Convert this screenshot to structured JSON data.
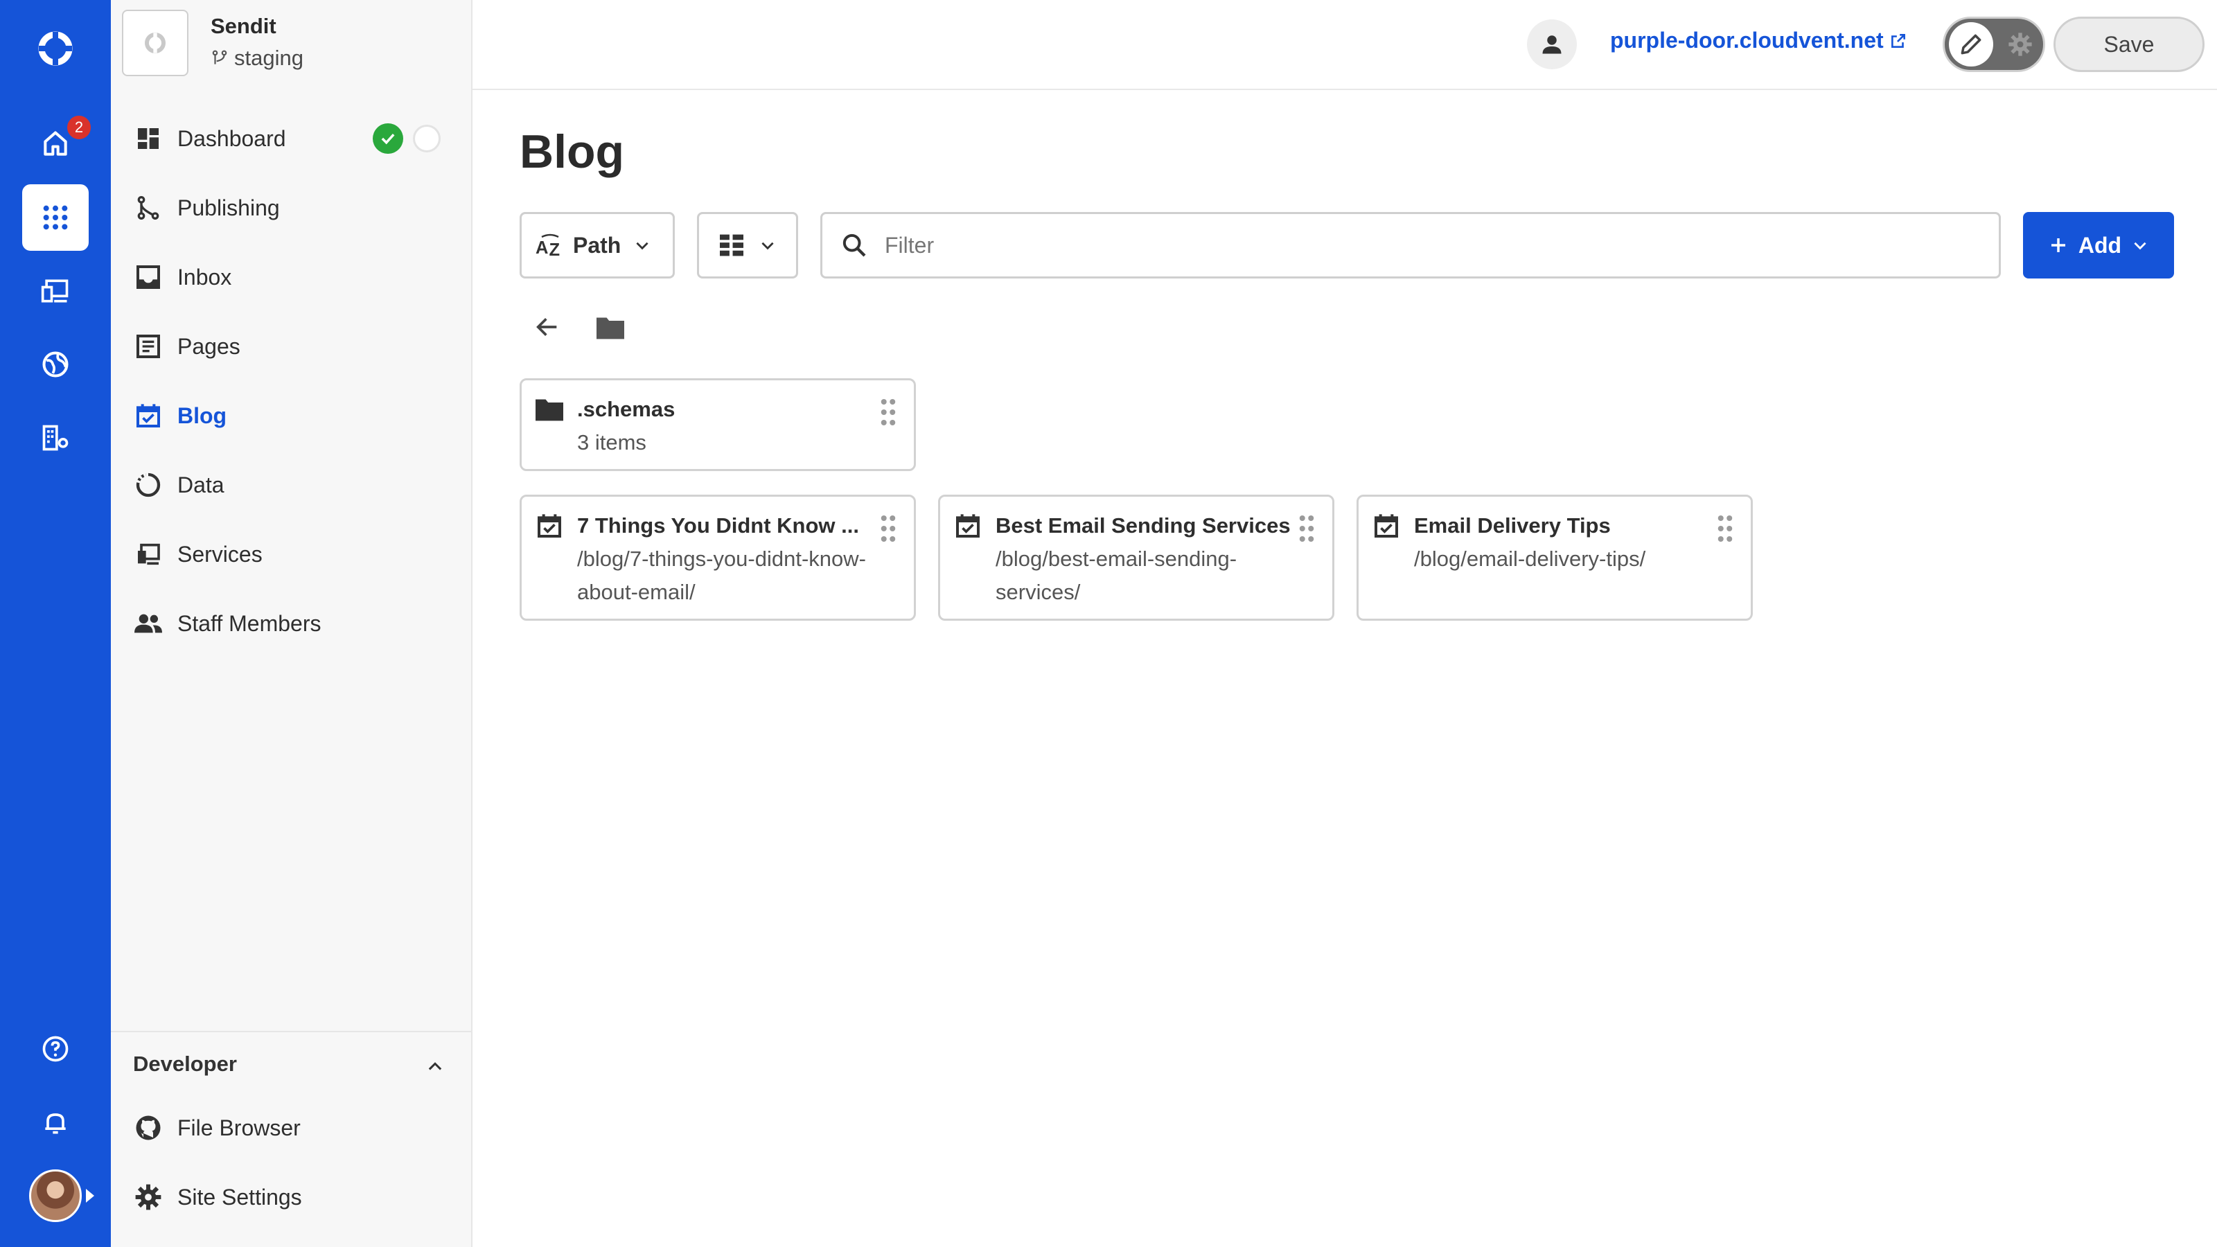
{
  "rail": {
    "home_badge": "2",
    "items": [
      "home-icon",
      "apps-icon",
      "devices-icon",
      "globe-icon",
      "buildings-icon"
    ],
    "bottom": [
      "help-icon",
      "bell-icon"
    ],
    "colors": {
      "brand": "#1554d8",
      "badge": "#d9322b"
    }
  },
  "site": {
    "name": "Sendit",
    "branch": "staging"
  },
  "nav": {
    "items": [
      {
        "label": "Dashboard",
        "icon": "dashboard-icon"
      },
      {
        "label": "Publishing",
        "icon": "publishing-icon"
      },
      {
        "label": "Inbox",
        "icon": "inbox-icon"
      },
      {
        "label": "Pages",
        "icon": "pages-icon"
      },
      {
        "label": "Blog",
        "icon": "blog-icon",
        "active": true
      },
      {
        "label": "Data",
        "icon": "data-icon"
      },
      {
        "label": "Services",
        "icon": "services-icon"
      },
      {
        "label": "Staff Members",
        "icon": "people-icon"
      }
    ],
    "developer": {
      "title": "Developer",
      "items": [
        {
          "label": "File Browser",
          "icon": "github-icon"
        },
        {
          "label": "Site Settings",
          "icon": "gear-icon"
        }
      ]
    }
  },
  "header": {
    "site_url": "purple-door.cloudvent.net",
    "save_label": "Save"
  },
  "main": {
    "title": "Blog",
    "sort_label": "Path",
    "filter_placeholder": "Filter",
    "add_label": "Add",
    "folder": {
      "name": ".schemas",
      "count": "3 items"
    },
    "posts": [
      {
        "title": "7 Things You Didnt Know ...",
        "path_line1": "/blog/7-things-you-didnt-know-",
        "path_line2": "about-email/"
      },
      {
        "title": "Best Email Sending Services",
        "path_line1": "/blog/best-email-sending-",
        "path_line2": "services/"
      },
      {
        "title": "Email Delivery Tips",
        "path_line1": "/blog/email-delivery-tips/",
        "path_line2": ""
      }
    ]
  }
}
